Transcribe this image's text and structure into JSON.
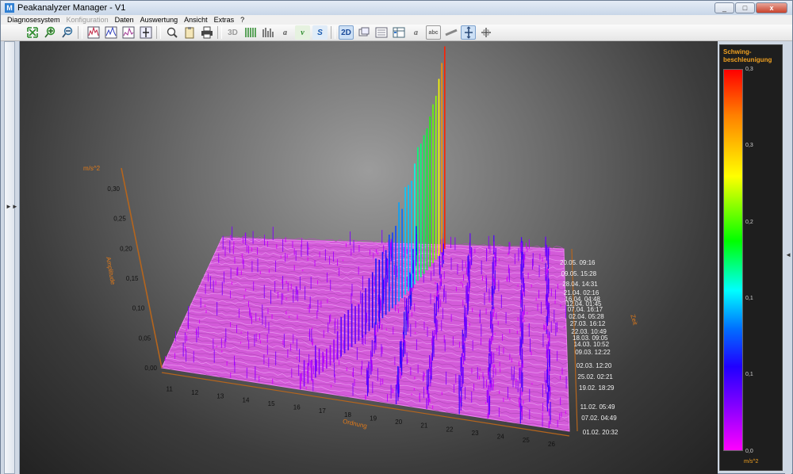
{
  "window": {
    "title": "Peakanalyzer Manager - V1",
    "icon": "M",
    "controls": [
      "minimize-icon",
      "restore-icon",
      "close-icon"
    ],
    "close_glyph": "x",
    "min_glyph": "_",
    "restore_glyph": "□"
  },
  "menu": [
    "Diagnosesystem",
    "Konfiguration",
    "Daten",
    "Auswertung",
    "Ansicht",
    "Extras",
    "?"
  ],
  "menu_disabled": [
    "Konfiguration"
  ],
  "toolbar": {
    "groups": [
      [
        "fit-icon",
        "zoom-in-icon",
        "zoom-out-icon"
      ],
      [
        "spectrum-view-1-icon",
        "spectrum-view-2-icon",
        "spectrum-view-3-icon",
        "marker-icon"
      ],
      [
        "search-icon",
        "clipboard-icon",
        "print-icon"
      ],
      [
        "3d-icon",
        "waterfall-icon",
        "bars-icon",
        "italic-a-icon",
        "v-icon",
        "s-icon"
      ],
      [
        "2d-icon",
        "layers-icon",
        "list-icon",
        "table-icon",
        "text-a-icon",
        "abc-icon",
        "ruler-icon",
        "cursor-icon",
        "split-icon"
      ]
    ],
    "labels": {
      "3d": "3D",
      "2d": "2D",
      "a": "a",
      "v": "v",
      "s": "S",
      "abc": "abc"
    }
  },
  "chart_data": {
    "type": "waterfall-3d",
    "x_axis": {
      "label": "Ordnung",
      "ticks": [
        "11",
        "12",
        "13",
        "14",
        "15",
        "16",
        "17",
        "18",
        "19",
        "20",
        "21",
        "22",
        "23",
        "24",
        "25",
        "26"
      ]
    },
    "y_axis": {
      "label": "Amplitude",
      "unit": "m/s^2",
      "ticks": [
        "0,00",
        "0,05",
        "0,10",
        "0,15",
        "0,20",
        "0,25",
        "0,30"
      ]
    },
    "z_axis": {
      "label": "Zeit",
      "ticks": [
        "20.05. 09:16",
        "09.05. 15:28",
        "28.04. 14:31",
        "21.04. 02:16",
        "16.04. 04:48",
        "12.04. 01:45",
        "07.04. 16:17",
        "02.04. 05:28",
        "27.03. 16:12",
        "22.03. 10:49",
        "18.03. 09:05",
        "14.03. 10:52",
        "09.03. 12:22",
        "02.03. 12:20",
        "25.02. 02:21",
        "19.02. 18:29",
        "11.02. 05:49",
        "07.02. 04:49",
        "01.02. 20:32"
      ]
    },
    "peak": {
      "x": 21.5,
      "amplitude_approx": 0.3
    },
    "colorscale": {
      "title": "Schwing-beschleunigung",
      "unit": "m/s^2",
      "ticks": [
        "0,3",
        "0,3",
        "0,2",
        "0,1",
        "0,1",
        "0,0"
      ],
      "colors": [
        "#ff0000",
        "#ffff00",
        "#00ff00",
        "#00ffff",
        "#0000ff",
        "#ff00ff"
      ]
    }
  }
}
